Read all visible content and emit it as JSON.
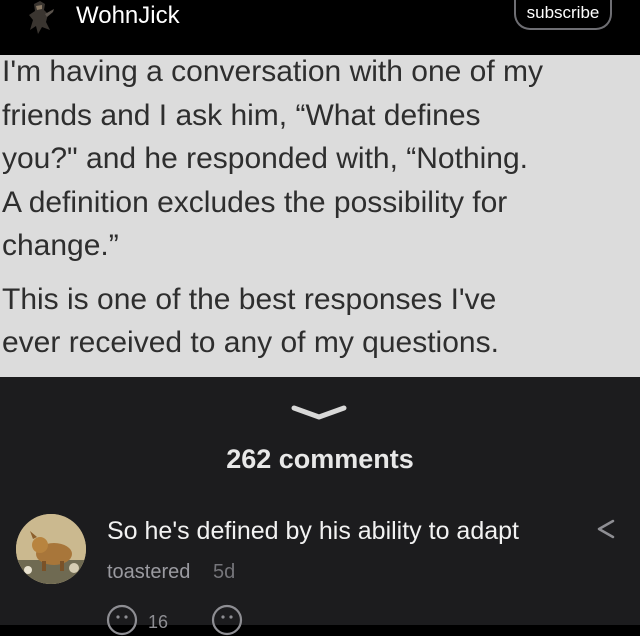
{
  "header": {
    "username": "WohnJick",
    "subscribe_label": "subscribe"
  },
  "post": {
    "paragraphs": [
      [
        "I'm having a conversation with one of my",
        "friends and I ask him, “What defines",
        "you?\" and he responded with, “Nothing.",
        "A definition excludes the possibility for",
        "change.”"
      ],
      [
        "This is one of the best responses I've",
        "ever received to any of my questions."
      ]
    ]
  },
  "comments_section": {
    "count_label": "262 comments"
  },
  "comment": {
    "text": "So he's defined by his ability to adapt",
    "author": "toastered",
    "time": "5d",
    "reaction_count": "16"
  },
  "icons": {
    "avatar": "ninja-avatar-icon",
    "collapse": "chevron-down-icon",
    "share": "share-icon",
    "react": "smiley-icon"
  },
  "colors": {
    "background": "#000000",
    "panel": "#1c1c1e",
    "image_bg": "#dcdcdc",
    "image_text": "#2e2e2e",
    "muted": "#9a9aa0"
  }
}
